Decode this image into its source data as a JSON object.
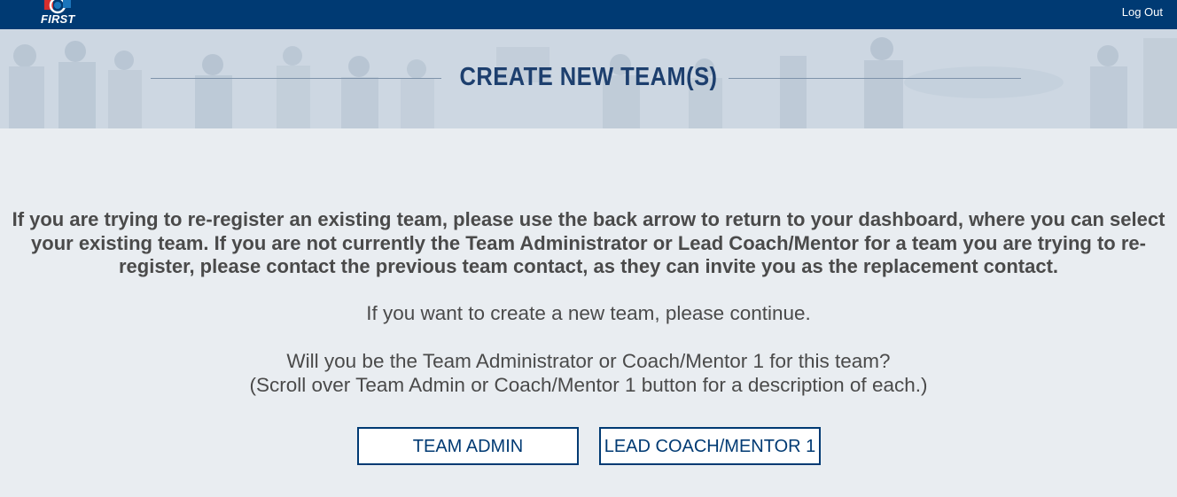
{
  "header": {
    "logo_text": "FIRST",
    "logout_label": "Log Out",
    "brand_color": "#003a73"
  },
  "banner": {
    "title": "CREATE NEW TEAM(S)"
  },
  "main": {
    "notice": "If you are trying to re-register an existing team, please use the back arrow to return to your dashboard, where you can select your existing team. If you are not currently the Team Administrator or Lead Coach/Mentor for a team you are trying to re-register, please contact the previous team contact, as they can invite you as the replacement contact.",
    "continue_text": "If you want to create a new team, please continue.",
    "question_line1": "Will you be the Team Administrator or Coach/Mentor 1 for this team?",
    "question_line2": "(Scroll over Team Admin or Coach/Mentor 1 button for a description of each.)",
    "buttons": {
      "team_admin": "TEAM ADMIN",
      "lead_coach": "LEAD COACH/MENTOR 1"
    }
  }
}
